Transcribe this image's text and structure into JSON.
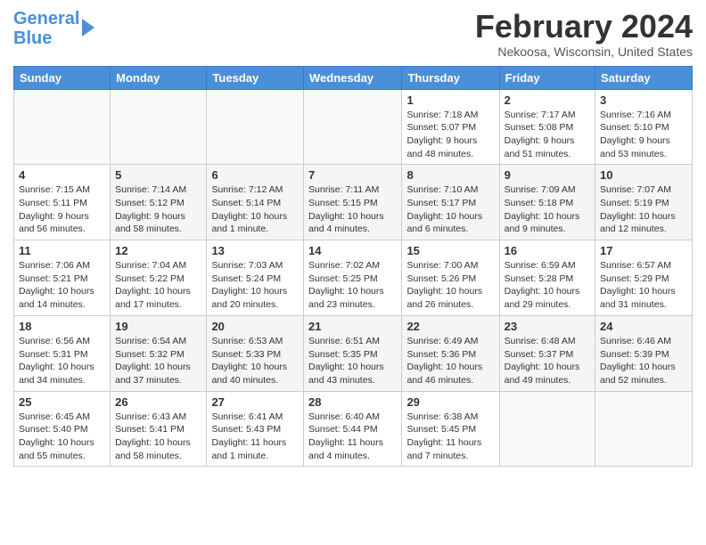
{
  "header": {
    "logo_line1": "General",
    "logo_line2": "Blue",
    "month_title": "February 2024",
    "location": "Nekoosa, Wisconsin, United States"
  },
  "weekdays": [
    "Sunday",
    "Monday",
    "Tuesday",
    "Wednesday",
    "Thursday",
    "Friday",
    "Saturday"
  ],
  "weeks": [
    [
      {
        "day": "",
        "info": ""
      },
      {
        "day": "",
        "info": ""
      },
      {
        "day": "",
        "info": ""
      },
      {
        "day": "",
        "info": ""
      },
      {
        "day": "1",
        "info": "Sunrise: 7:18 AM\nSunset: 5:07 PM\nDaylight: 9 hours\nand 48 minutes."
      },
      {
        "day": "2",
        "info": "Sunrise: 7:17 AM\nSunset: 5:08 PM\nDaylight: 9 hours\nand 51 minutes."
      },
      {
        "day": "3",
        "info": "Sunrise: 7:16 AM\nSunset: 5:10 PM\nDaylight: 9 hours\nand 53 minutes."
      }
    ],
    [
      {
        "day": "4",
        "info": "Sunrise: 7:15 AM\nSunset: 5:11 PM\nDaylight: 9 hours\nand 56 minutes."
      },
      {
        "day": "5",
        "info": "Sunrise: 7:14 AM\nSunset: 5:12 PM\nDaylight: 9 hours\nand 58 minutes."
      },
      {
        "day": "6",
        "info": "Sunrise: 7:12 AM\nSunset: 5:14 PM\nDaylight: 10 hours\nand 1 minute."
      },
      {
        "day": "7",
        "info": "Sunrise: 7:11 AM\nSunset: 5:15 PM\nDaylight: 10 hours\nand 4 minutes."
      },
      {
        "day": "8",
        "info": "Sunrise: 7:10 AM\nSunset: 5:17 PM\nDaylight: 10 hours\nand 6 minutes."
      },
      {
        "day": "9",
        "info": "Sunrise: 7:09 AM\nSunset: 5:18 PM\nDaylight: 10 hours\nand 9 minutes."
      },
      {
        "day": "10",
        "info": "Sunrise: 7:07 AM\nSunset: 5:19 PM\nDaylight: 10 hours\nand 12 minutes."
      }
    ],
    [
      {
        "day": "11",
        "info": "Sunrise: 7:06 AM\nSunset: 5:21 PM\nDaylight: 10 hours\nand 14 minutes."
      },
      {
        "day": "12",
        "info": "Sunrise: 7:04 AM\nSunset: 5:22 PM\nDaylight: 10 hours\nand 17 minutes."
      },
      {
        "day": "13",
        "info": "Sunrise: 7:03 AM\nSunset: 5:24 PM\nDaylight: 10 hours\nand 20 minutes."
      },
      {
        "day": "14",
        "info": "Sunrise: 7:02 AM\nSunset: 5:25 PM\nDaylight: 10 hours\nand 23 minutes."
      },
      {
        "day": "15",
        "info": "Sunrise: 7:00 AM\nSunset: 5:26 PM\nDaylight: 10 hours\nand 26 minutes."
      },
      {
        "day": "16",
        "info": "Sunrise: 6:59 AM\nSunset: 5:28 PM\nDaylight: 10 hours\nand 29 minutes."
      },
      {
        "day": "17",
        "info": "Sunrise: 6:57 AM\nSunset: 5:29 PM\nDaylight: 10 hours\nand 31 minutes."
      }
    ],
    [
      {
        "day": "18",
        "info": "Sunrise: 6:56 AM\nSunset: 5:31 PM\nDaylight: 10 hours\nand 34 minutes."
      },
      {
        "day": "19",
        "info": "Sunrise: 6:54 AM\nSunset: 5:32 PM\nDaylight: 10 hours\nand 37 minutes."
      },
      {
        "day": "20",
        "info": "Sunrise: 6:53 AM\nSunset: 5:33 PM\nDaylight: 10 hours\nand 40 minutes."
      },
      {
        "day": "21",
        "info": "Sunrise: 6:51 AM\nSunset: 5:35 PM\nDaylight: 10 hours\nand 43 minutes."
      },
      {
        "day": "22",
        "info": "Sunrise: 6:49 AM\nSunset: 5:36 PM\nDaylight: 10 hours\nand 46 minutes."
      },
      {
        "day": "23",
        "info": "Sunrise: 6:48 AM\nSunset: 5:37 PM\nDaylight: 10 hours\nand 49 minutes."
      },
      {
        "day": "24",
        "info": "Sunrise: 6:46 AM\nSunset: 5:39 PM\nDaylight: 10 hours\nand 52 minutes."
      }
    ],
    [
      {
        "day": "25",
        "info": "Sunrise: 6:45 AM\nSunset: 5:40 PM\nDaylight: 10 hours\nand 55 minutes."
      },
      {
        "day": "26",
        "info": "Sunrise: 6:43 AM\nSunset: 5:41 PM\nDaylight: 10 hours\nand 58 minutes."
      },
      {
        "day": "27",
        "info": "Sunrise: 6:41 AM\nSunset: 5:43 PM\nDaylight: 11 hours\nand 1 minute."
      },
      {
        "day": "28",
        "info": "Sunrise: 6:40 AM\nSunset: 5:44 PM\nDaylight: 11 hours\nand 4 minutes."
      },
      {
        "day": "29",
        "info": "Sunrise: 6:38 AM\nSunset: 5:45 PM\nDaylight: 11 hours\nand 7 minutes."
      },
      {
        "day": "",
        "info": ""
      },
      {
        "day": "",
        "info": ""
      }
    ]
  ]
}
